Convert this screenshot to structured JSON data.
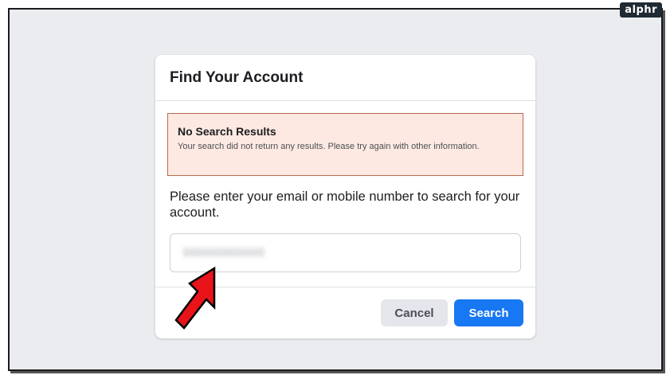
{
  "watermark": "alphr",
  "dialog": {
    "title": "Find Your Account",
    "alert": {
      "title": "No Search Results",
      "message": "Your search did not return any results. Please try again with other information."
    },
    "prompt": "Please enter your email or mobile number to search for your account.",
    "input": {
      "value": "00000000000"
    },
    "buttons": {
      "cancel": "Cancel",
      "search": "Search"
    }
  },
  "colors": {
    "accent": "#1877f2",
    "alert_bg": "#fde9e1",
    "alert_border": "#b96a4e",
    "annotation_arrow": "#e8141a"
  },
  "icons": {
    "annotation": "red-arrow-icon"
  }
}
